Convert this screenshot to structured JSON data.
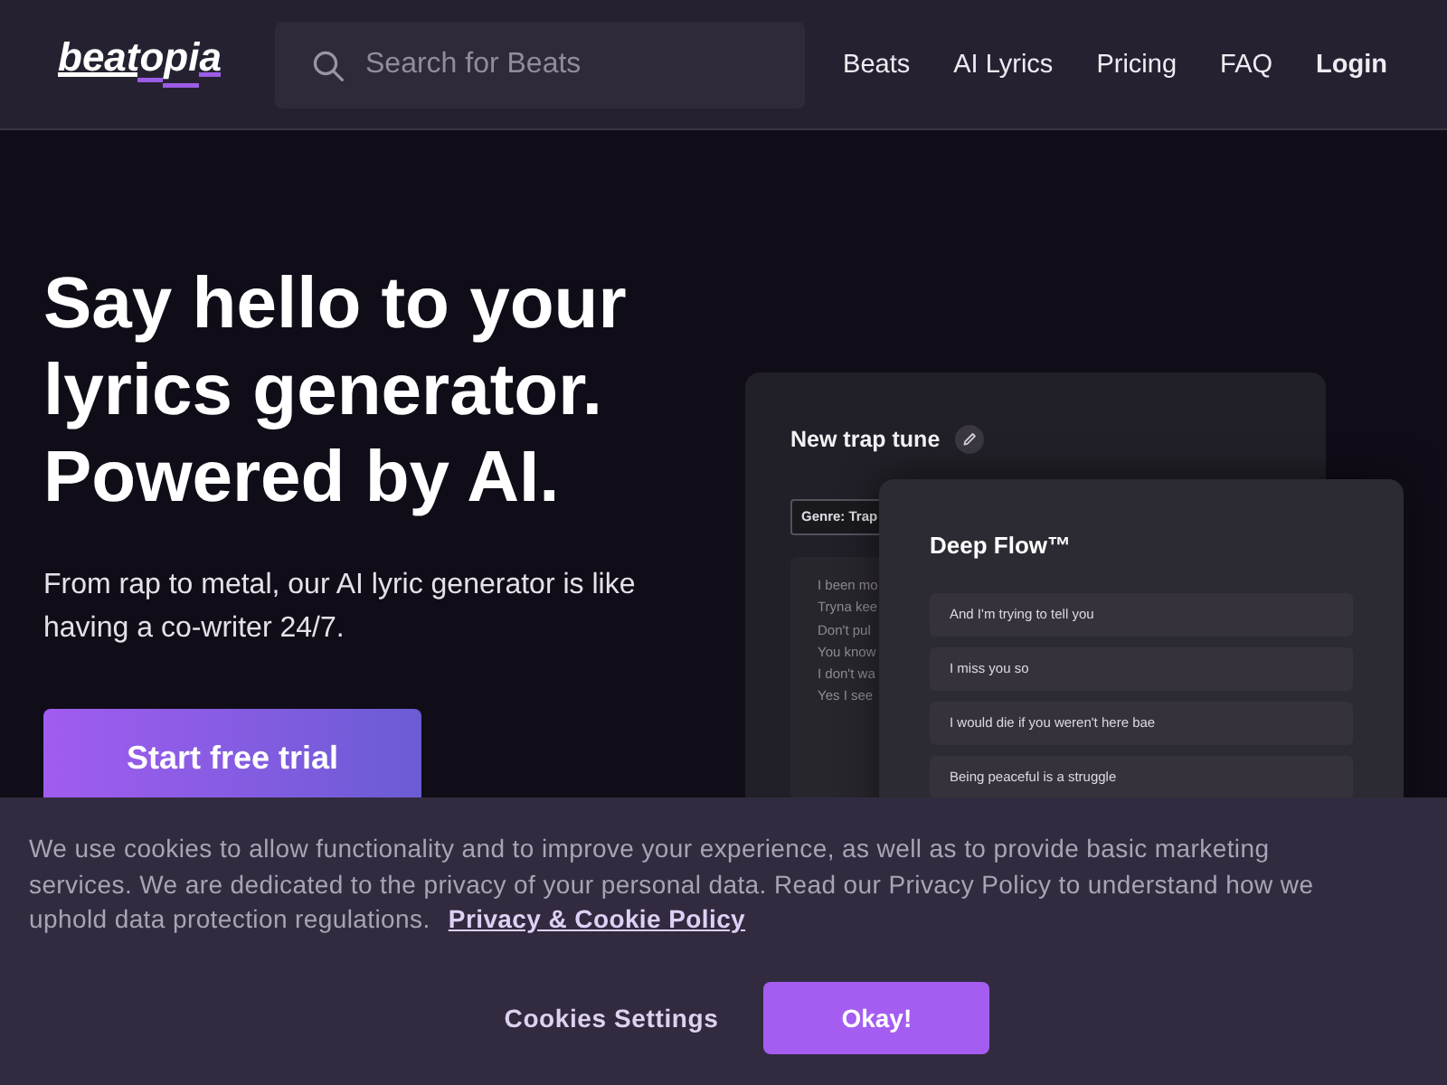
{
  "header": {
    "logo": "beatopia",
    "search": {
      "placeholder": "Search for Beats"
    },
    "nav": [
      {
        "label": "Beats",
        "kind": "link"
      },
      {
        "label": "AI Lyrics",
        "kind": "link"
      },
      {
        "label": "Pricing",
        "kind": "link"
      },
      {
        "label": "FAQ",
        "kind": "link"
      },
      {
        "label": "Login",
        "kind": "login"
      }
    ]
  },
  "hero": {
    "title": "Say hello to your lyrics generator. Powered by AI.",
    "subtitle": "From rap to metal, our AI lyric generator is like having a co-writer 24/7.",
    "cta": "Start free trial"
  },
  "preview": {
    "editor_card": {
      "title": "New trap tune",
      "genre": "Genre: Trap",
      "lyrics": [
        "I been mo",
        "Tryna kee",
        "Don't pul",
        "You know",
        "I don't wa",
        "Yes I see"
      ]
    },
    "suggestion_card": {
      "title": "Deep Flow™",
      "suggestions": [
        "And I'm trying to tell you",
        "I miss you so",
        "I would die if you weren't here bae",
        "Being peaceful is a struggle"
      ]
    }
  },
  "cookie_banner": {
    "text": "We use cookies to allow functionality and to improve your experience, as well as to provide basic marketing services. We are dedicated to the privacy of your personal data. Read our Privacy Policy to understand how we uphold data protection regulations.",
    "link": "Privacy & Cookie Policy",
    "buttons": [
      {
        "label": "Cookies Settings",
        "kind": "secondary"
      },
      {
        "label": "Okay!",
        "kind": "primary"
      }
    ]
  }
}
